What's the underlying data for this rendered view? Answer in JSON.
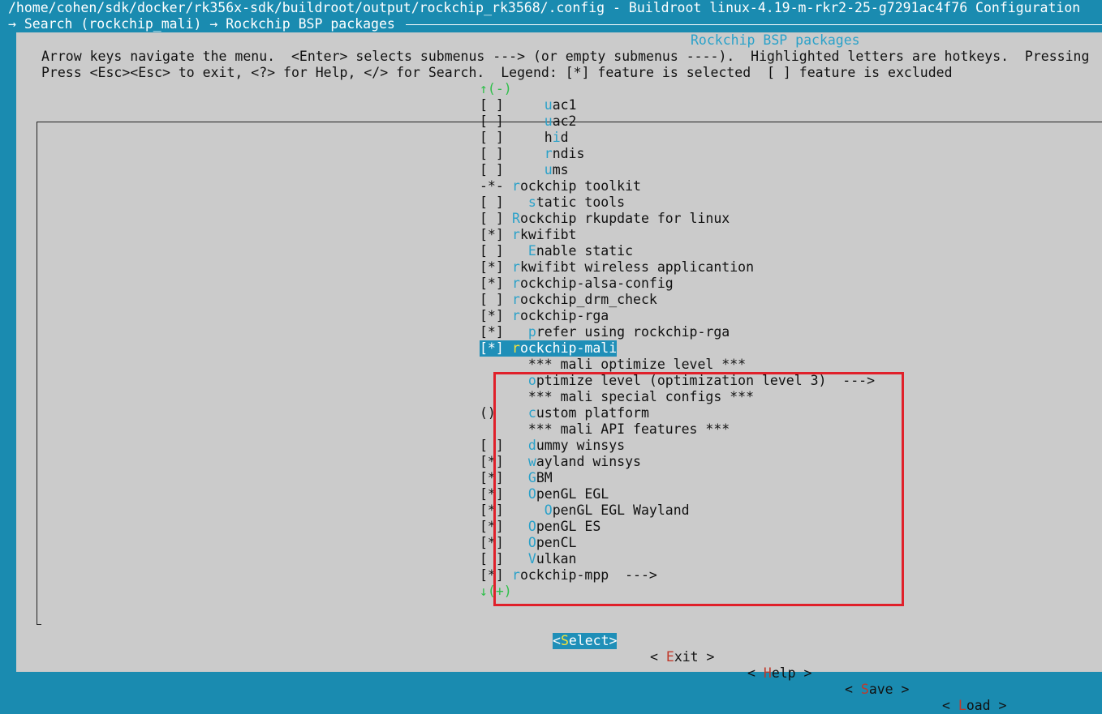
{
  "window": {
    "title": "/home/cohen/sdk/docker/rk356x-sdk/buildroot/output/rockchip_rk3568/.config - Buildroot linux-4.19-m-rkr2-25-g7291ac4f76 Configuration",
    "breadcrumb": "→ Search (rockchip_mali) → Rockchip BSP packages"
  },
  "dialog": {
    "title": "Rockchip BSP packages",
    "help_line1": "Arrow keys navigate the menu.  <Enter> selects submenus ---> (or empty submenus ----).  Highlighted letters are hotkeys.  Pressing",
    "help_line2": "Press <Esc><Esc> to exit, <?> for Help, </> for Search.  Legend: [*] feature is selected  [ ] feature is excluded"
  },
  "menu": {
    "scroll_up": "↑(-)",
    "scroll_down": "↓(+)",
    "items": [
      {
        "state": "[ ]",
        "indent": "    ",
        "hot": "u",
        "rest": "ac1"
      },
      {
        "state": "[ ]",
        "indent": "    ",
        "hot": "u",
        "rest": "ac2"
      },
      {
        "state": "[ ]",
        "indent": "    ",
        "hot": "h",
        "mid": "i",
        "rest": "d"
      },
      {
        "state": "[ ]",
        "indent": "    ",
        "hot": "r",
        "rest": "ndis"
      },
      {
        "state": "[ ]",
        "indent": "    ",
        "hot": "u",
        "rest": "ms"
      },
      {
        "state": "-*-",
        "indent": "",
        "hot": "r",
        "rest": "ockchip toolkit"
      },
      {
        "state": "[ ]",
        "indent": "  ",
        "hot": "s",
        "rest": "tatic tools"
      },
      {
        "state": "[ ]",
        "indent": "",
        "hot": "R",
        "rest": "ockchip rkupdate for linux"
      },
      {
        "state": "[*]",
        "indent": "",
        "hot": "r",
        "rest": "kwifibt"
      },
      {
        "state": "[ ]",
        "indent": "  ",
        "hot": "E",
        "rest": "nable static"
      },
      {
        "state": "[*]",
        "indent": "",
        "hot": "r",
        "rest": "kwifibt wireless applicantion"
      },
      {
        "state": "[*]",
        "indent": "",
        "hot": "r",
        "rest": "ockchip-alsa-config"
      },
      {
        "state": "[ ]",
        "indent": "",
        "hot": "r",
        "rest": "ockchip_drm_check"
      },
      {
        "state": "[*]",
        "indent": "",
        "hot": "r",
        "rest": "ockchip-rga"
      },
      {
        "state": "[*]",
        "indent": "  ",
        "hot": "p",
        "rest": "refer using rockchip-rga"
      },
      {
        "state": "[*]",
        "indent": "",
        "hot": "r",
        "rest": "ockchip-mali",
        "selected": true
      },
      {
        "state": "",
        "indent": "  ",
        "hot": "",
        "rest": "*** mali optimize level ***"
      },
      {
        "state": "",
        "indent": "  ",
        "hot": "o",
        "rest": "ptimize level (optimization level 3)  --->"
      },
      {
        "state": "",
        "indent": "  ",
        "hot": "",
        "rest": "*** mali special configs ***"
      },
      {
        "state": "()",
        "indent": "  ",
        "hot": "c",
        "rest": "ustom platform"
      },
      {
        "state": "",
        "indent": "  ",
        "hot": "",
        "rest": "*** mali API features ***"
      },
      {
        "state": "[ ]",
        "indent": "  ",
        "hot": "d",
        "rest": "ummy winsys"
      },
      {
        "state": "[*]",
        "indent": "  ",
        "hot": "w",
        "rest": "ayland winsys"
      },
      {
        "state": "[*]",
        "indent": "  ",
        "hot": "G",
        "rest": "BM"
      },
      {
        "state": "[*]",
        "indent": "  ",
        "hot": "O",
        "rest": "penGL EGL"
      },
      {
        "state": "[*]",
        "indent": "    ",
        "hot": "O",
        "rest": "penGL EGL Wayland"
      },
      {
        "state": "[*]",
        "indent": "  ",
        "hot": "O",
        "rest": "penGL ES"
      },
      {
        "state": "[*]",
        "indent": "  ",
        "hot": "O",
        "rest": "penCL"
      },
      {
        "state": "[ ]",
        "indent": "  ",
        "hot": "V",
        "rest": "ulkan"
      },
      {
        "state": "[*]",
        "indent": "",
        "hot": "r",
        "rest": "ockchip-mpp  --->"
      }
    ]
  },
  "buttons": {
    "select": {
      "open": "<",
      "hot": "S",
      "rest": "elect>"
    },
    "exit": {
      "open": "< ",
      "hot": "E",
      "rest": "xit >"
    },
    "help": {
      "open": "< ",
      "hot": "H",
      "rest": "elp >"
    },
    "save": {
      "open": "< ",
      "hot": "S",
      "rest": "ave >"
    },
    "load": {
      "open": "< ",
      "hot": "L",
      "rest": "oad >"
    }
  },
  "colors": {
    "background": "#1a8bb0",
    "dialog": "#cbcbcb",
    "hotkey": "#2aa1c9",
    "selected_bg": "#1f8fb8",
    "annotation_box": "#e0202a"
  }
}
